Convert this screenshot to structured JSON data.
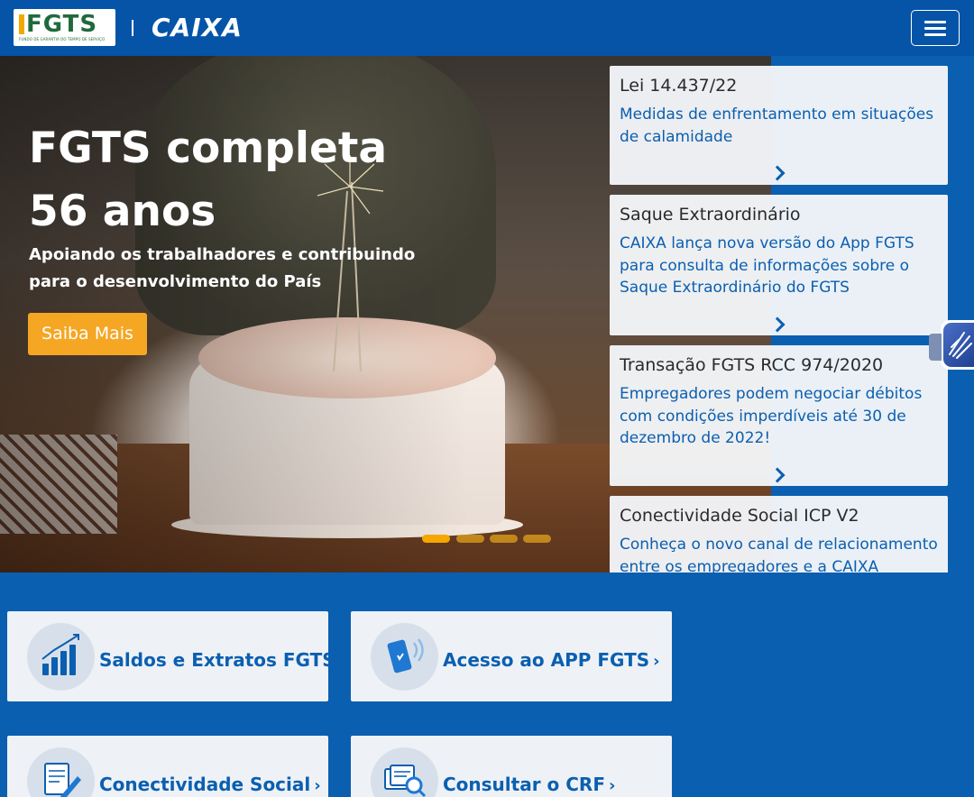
{
  "header": {
    "fgts_logo_text": "FGTS",
    "fgts_logo_subtitle": "FUNDO DE GARANTIA DO TEMPO DE SERVIÇO",
    "caixa_logo_text": "CAIXA",
    "menu_icon": "hamburger-menu-icon"
  },
  "hero": {
    "title_line1": "FGTS completa",
    "title_line2": "56 anos",
    "subtitle": "Apoiando os trabalhadores e contribuindo para o desenvolvimento do País",
    "button_label": "Saiba Mais",
    "carousel_slides": 4,
    "active_slide": 1,
    "colors": {
      "button": "#f5a623",
      "dot": "#f5a700"
    }
  },
  "news": [
    {
      "title": "Lei 14.437/22",
      "description": "Medidas de enfrentamento em situações de calamidade"
    },
    {
      "title": "Saque Extraordinário",
      "description": "CAIXA lança nova versão do App FGTS para consulta de informações sobre o Saque Extraordinário do FGTS"
    },
    {
      "title": "Transação FGTS RCC 974/2020",
      "description": "Empregadores podem negociar débitos com condições imperdíveis até 30 de dezembro de 2022!"
    },
    {
      "title": "Conectividade Social ICP V2",
      "description": "Conheça o novo canal de relacionamento entre os empregadores e a CAIXA"
    }
  ],
  "services": [
    {
      "label": "Saldos e Extratos FGTS",
      "icon": "bar-chart-icon"
    },
    {
      "label": "Acesso ao APP FGTS",
      "icon": "mobile-phone-icon"
    },
    {
      "label": "Conectividade Social",
      "icon": "document-pen-icon"
    },
    {
      "label": "Consultar o CRF",
      "icon": "document-search-icon"
    }
  ],
  "accessibility": {
    "icon": "sign-language-hands-icon"
  },
  "colors": {
    "brand_blue": "#0b5fb0",
    "header_blue": "#0554a8",
    "accent_orange": "#f39200"
  }
}
